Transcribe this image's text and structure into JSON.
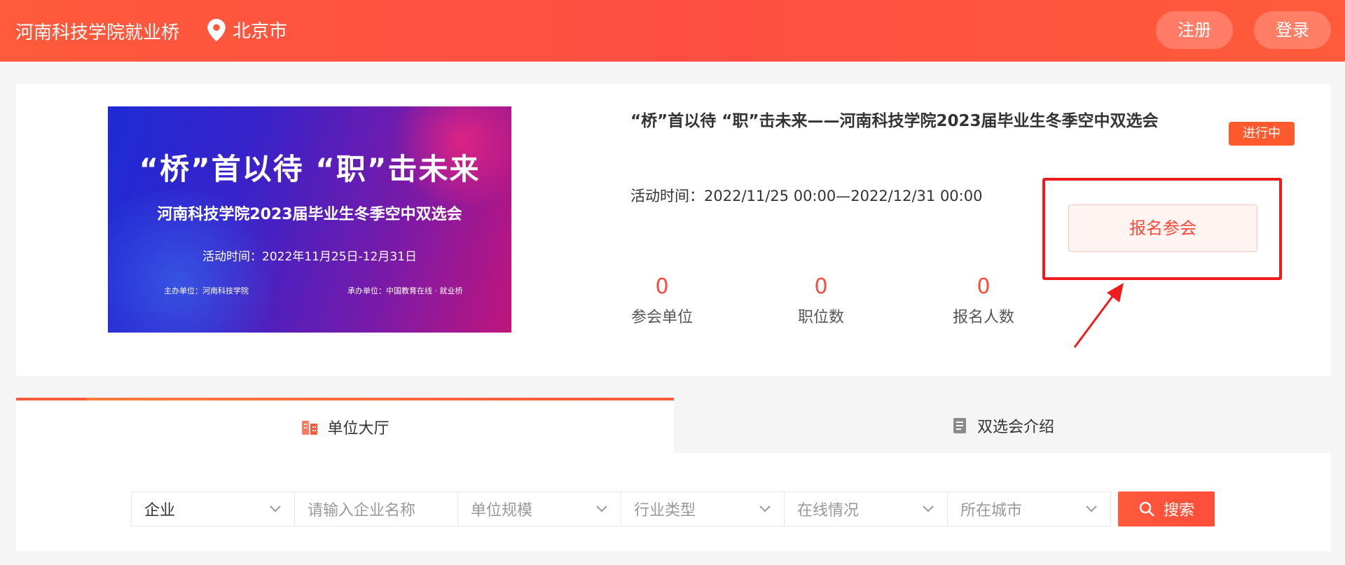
{
  "header": {
    "site_name": "河南科技学院就业桥",
    "location": "北京市",
    "register_label": "注册",
    "login_label": "登录"
  },
  "banner": {
    "headline": "“桥”首以待 “职”击未来",
    "subtitle": "河南科技学院2023届毕业生冬季空中双选会",
    "date_line": "活动时间：2022年11月25日-12月31日",
    "host": "主办单位：河南科技学院",
    "organizer": "承办单位：中国教育在线 · 就业桥"
  },
  "fair": {
    "title": "“桥”首以待 “职”击未来——河南科技学院2023届毕业生冬季空中双选会",
    "status": "进行中",
    "time_label": "活动时间：",
    "time_value": "2022/11/25 00:00—2022/12/31 00:00",
    "signup_label": "报名参会",
    "stats": [
      {
        "value": "0",
        "label": "参会单位"
      },
      {
        "value": "0",
        "label": "职位数"
      },
      {
        "value": "0",
        "label": "报名人数"
      }
    ]
  },
  "tabs": [
    {
      "label": "单位大厅",
      "active": true
    },
    {
      "label": "双选会介绍",
      "active": false
    }
  ],
  "filters": {
    "type_value": "企业",
    "company_placeholder": "请输入企业名称",
    "scale_placeholder": "单位规模",
    "industry_placeholder": "行业类型",
    "online_placeholder": "在线情况",
    "city_placeholder": "所在城市",
    "search_label": "搜索"
  },
  "colors": {
    "brand": "#ff5a3c",
    "accent_text": "#ff4a3a",
    "highlight_box": "#ee1c1c"
  }
}
